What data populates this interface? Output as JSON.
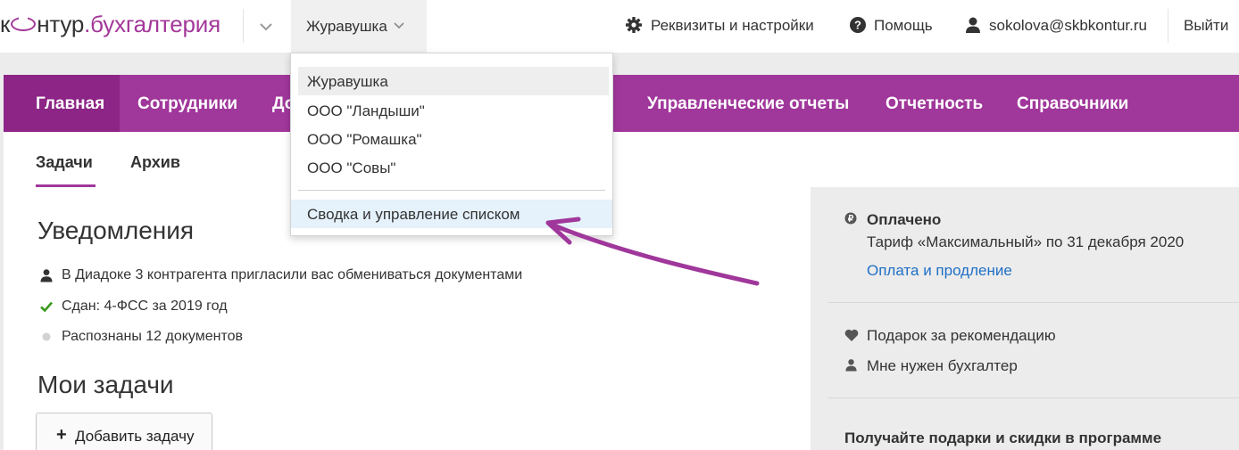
{
  "header": {
    "logo": {
      "part1": "к",
      "part2": "нтур",
      "dot": ".",
      "product": "бухгалтерия"
    },
    "org_selector": "Журавушка",
    "settings_link": "Реквизиты и настройки",
    "help_link": "Помощь",
    "user_email": "sokolova@skbkontur.ru",
    "logout_link": "Выйти"
  },
  "nav": {
    "items": [
      {
        "label": "Главная",
        "active": true
      },
      {
        "label": "Сотрудники"
      },
      {
        "label": "До"
      },
      {
        "label": "Управленческие отчеты"
      },
      {
        "label": "Отчетность"
      },
      {
        "label": "Справочники"
      }
    ]
  },
  "subnav": {
    "items": [
      "Задачи",
      "Архив"
    ]
  },
  "notifications": {
    "title": "Уведомления",
    "items": [
      {
        "icon": "person-icon",
        "text": "В Диадоке 3 контрагента пригласили вас обмениваться документами"
      },
      {
        "icon": "check-icon",
        "text": "Сдан: 4-ФСС за 2019 год"
      },
      {
        "icon": "dot-icon",
        "text": "Распознаны 12 документов"
      }
    ]
  },
  "tasks": {
    "title": "Мои задачи",
    "add_button": "Добавить задачу"
  },
  "sidebar": {
    "paid_title": "Оплачено",
    "tariff": "Тариф «Максимальный» по 31 декабря 2020",
    "payment_link": "Оплата и продление",
    "gift_link": "Подарок за рекомендацию",
    "need_accountant": "Мне нужен бухгалтер",
    "program_title": "Получайте подарки и скидки в программе"
  },
  "dropdown": {
    "items": [
      "Журавушка",
      "ООО \"Ландыши\"",
      "ООО \"Ромашка\"",
      "ООО \"Совы\""
    ],
    "summary": "Сводка и управление списком"
  },
  "colors": {
    "brand": "#a0379b",
    "nav_active": "#8c2586",
    "link": "#1f6fc5",
    "check": "#3a9a1f",
    "arrow": "#a0379b"
  }
}
